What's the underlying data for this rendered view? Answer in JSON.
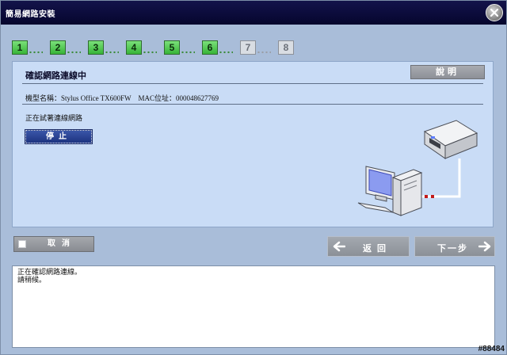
{
  "window": {
    "title": "簡易網路安裝"
  },
  "steps": [
    {
      "label": "1",
      "state": "done"
    },
    {
      "label": "2",
      "state": "done"
    },
    {
      "label": "3",
      "state": "done"
    },
    {
      "label": "4",
      "state": "done"
    },
    {
      "label": "5",
      "state": "done"
    },
    {
      "label": "6",
      "state": "done"
    },
    {
      "label": "7",
      "state": "todo"
    },
    {
      "label": "8",
      "state": "todo"
    }
  ],
  "panel": {
    "title": "確認網路連線中",
    "help_label": "說明",
    "model_line": "機型名稱：Stylus Office TX600FW　MAC位址：000048627769",
    "status_text": "正在試著連線網路",
    "stop_label": "停止"
  },
  "footer": {
    "cancel_label": "取消",
    "back_label": "返回",
    "next_label": "下一步"
  },
  "messages": [
    "正在確認網路連線。",
    "請稍候。"
  ],
  "build_id": "#88484",
  "colors": {
    "titlebar": "#0b0b3a",
    "window_bg": "#a9bdd9",
    "panel_bg": "#c9dcf6",
    "step_done": "#4cc24c",
    "step_todo": "#d9dde3",
    "stop_button": "#2a4392",
    "cable_dash": "#c21a1a"
  }
}
